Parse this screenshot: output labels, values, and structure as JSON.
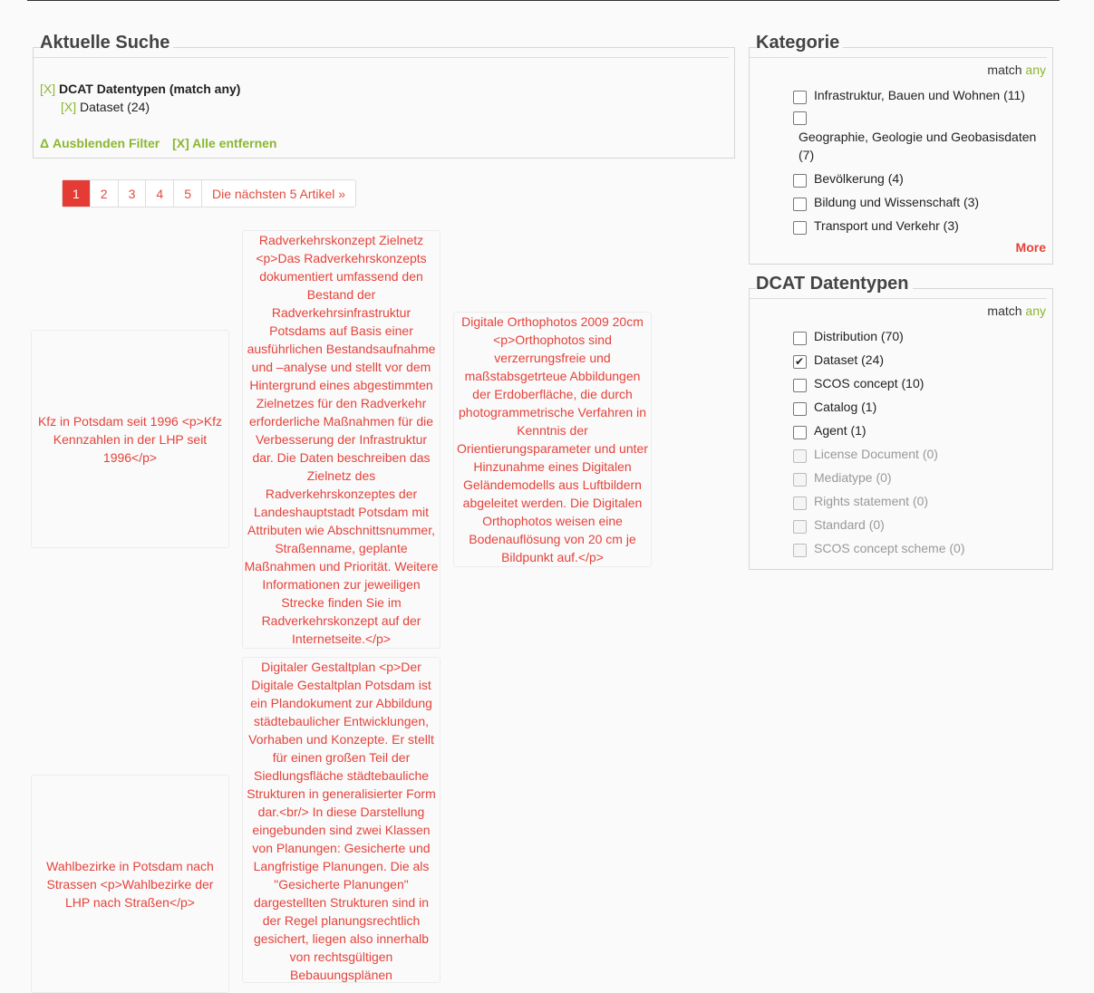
{
  "current_search": {
    "title": "Aktuelle Suche",
    "facet_remove": "[X]",
    "facet_label": "DCAT Datentypen (match any)",
    "value_remove": "[X]",
    "value_label": "Dataset (24)",
    "hide_filter": "Δ Ausblenden Filter",
    "remove_all": "[X] Alle entfernen"
  },
  "pager": {
    "pages": [
      "1",
      "2",
      "3",
      "4",
      "5"
    ],
    "next_label": "Die nächsten 5 Artikel »"
  },
  "results": [
    {
      "text": "Kfz in Potsdam seit 1996 <p>Kfz Kennzahlen in der LHP seit 1996</p>"
    },
    {
      "text": "Radverkehrskonzept Zielnetz <p>Das Radverkehrskonzepts dokumentiert umfassend den Bestand der Radverkehrsinfrastruktur Potsdams auf Basis einer ausführlichen Bestandsaufnahme und –analyse und stellt vor dem Hintergrund eines abgestimmten Zielnetzes für den Radverkehr erforderliche Maßnahmen für die Verbesserung der Infrastruktur dar. Die Daten beschreiben das Zielnetz des Radverkehrskonzeptes der Landeshauptstadt Potsdam mit Attributen wie Abschnittsnummer, Straßenname, geplante Maßnahmen und Priorität. Weitere Informationen zur jeweiligen Strecke finden Sie im Radverkehrskonzept auf der Internetseite.</p>"
    },
    {
      "text": "Digitale Orthophotos 2009 20cm <p>Orthophotos sind verzerrungsfreie und maßstabsgetrteue Abbildungen der Erdoberfläche, die durch photogrammetrische Verfahren in Kenntnis der Orientierungsparameter und unter Hinzunahme eines Digitalen Geländemodells aus Luftbildern abgeleitet werden. Die Digitalen Orthophotos weisen eine Bodenauflösung von 20 cm je Bildpunkt auf.</p>"
    },
    {
      "text": "Wahlbezirke in Potsdam nach Strassen <p>Wahlbezirke der LHP nach Straßen</p>"
    },
    {
      "text": "Digitaler Gestaltplan <p>Der Digitale Gestaltplan Potsdam ist ein Plandokument zur Abbildung städtebaulicher Entwicklungen, Vorhaben und Konzepte. Er stellt für einen großen Teil der Siedlungsfläche städtebauliche Strukturen in generalisierter Form dar.<br/> In diese Darstellung eingebunden sind zwei Klassen von Planungen: Gesicherte und Langfristige Planungen. Die als \"Gesicherte Planungen\" dargestellten Strukturen sind in der Regel planungsrechtlich gesichert, liegen also innerhalb von rechtsgültigen Bebauungsplänen"
    }
  ],
  "kategorie": {
    "title": "Kategorie",
    "match_prefix": "match",
    "match_value": "any",
    "items": [
      {
        "label": "Infrastruktur, Bauen und Wohnen (11)"
      },
      {
        "label": "Geographie, Geologie und Geobasisdaten (7)"
      },
      {
        "label": "Bevölkerung (4)"
      },
      {
        "label": "Bildung und Wissenschaft (3)"
      },
      {
        "label": "Transport und Verkehr (3)"
      }
    ],
    "more_label": "More"
  },
  "dcat": {
    "title": "DCAT Datentypen",
    "match_prefix": "match",
    "match_value": "any",
    "items": [
      {
        "label": "Distribution (70)",
        "checked": false,
        "disabled": false
      },
      {
        "label": "Dataset (24)",
        "checked": true,
        "disabled": false
      },
      {
        "label": "SCOS concept (10)",
        "checked": false,
        "disabled": false
      },
      {
        "label": "Catalog (1)",
        "checked": false,
        "disabled": false
      },
      {
        "label": "Agent (1)",
        "checked": false,
        "disabled": false
      },
      {
        "label": "License Document (0)",
        "checked": false,
        "disabled": true
      },
      {
        "label": "Mediatype (0)",
        "checked": false,
        "disabled": true
      },
      {
        "label": "Rights statement (0)",
        "checked": false,
        "disabled": true
      },
      {
        "label": "Standard (0)",
        "checked": false,
        "disabled": true
      },
      {
        "label": "SCOS concept scheme (0)",
        "checked": false,
        "disabled": true
      }
    ]
  },
  "colors": {
    "accent_red": "#e5433b",
    "accent_green": "#8bb72f"
  }
}
